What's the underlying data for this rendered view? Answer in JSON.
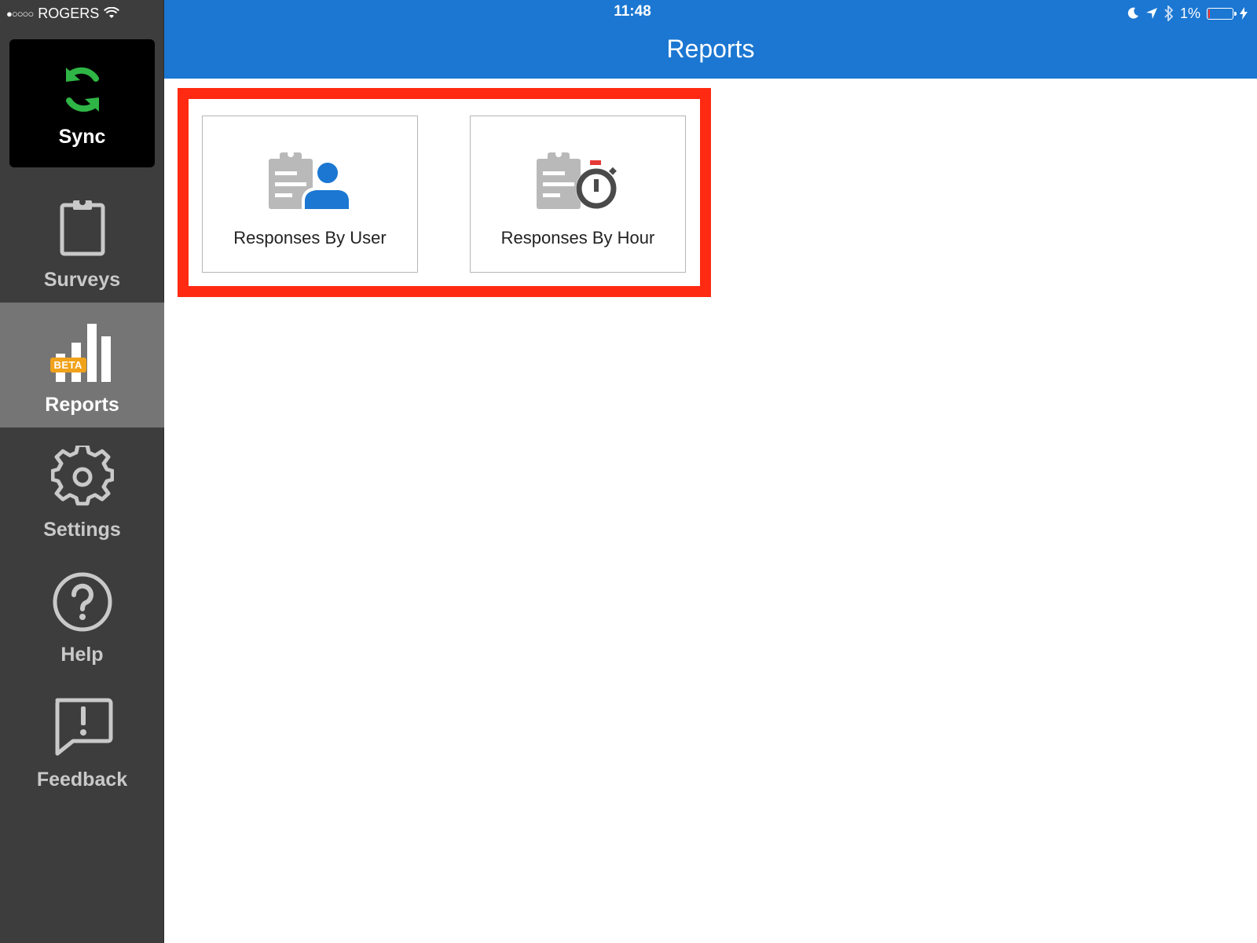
{
  "status_bar": {
    "signal": "●○○○○",
    "carrier": "ROGERS",
    "time": "11:48",
    "battery": "1%"
  },
  "header": {
    "title": "Reports",
    "color": "#1b77d2"
  },
  "sidebar": {
    "items": [
      {
        "label": "Sync",
        "icon": "sync-icon"
      },
      {
        "label": "Surveys",
        "icon": "clipboard-icon"
      },
      {
        "label": "Reports",
        "icon": "bar-chart-icon",
        "badge": "BETA",
        "active": true
      },
      {
        "label": "Settings",
        "icon": "gear-icon"
      },
      {
        "label": "Help",
        "icon": "help-icon"
      },
      {
        "label": "Feedback",
        "icon": "feedback-icon"
      }
    ]
  },
  "reports": {
    "cards": [
      {
        "label": "Responses By User",
        "icon": "clipboard-user-icon"
      },
      {
        "label": "Responses By Hour",
        "icon": "clipboard-stopwatch-icon"
      }
    ],
    "highlight_color": "#ff2a12"
  }
}
